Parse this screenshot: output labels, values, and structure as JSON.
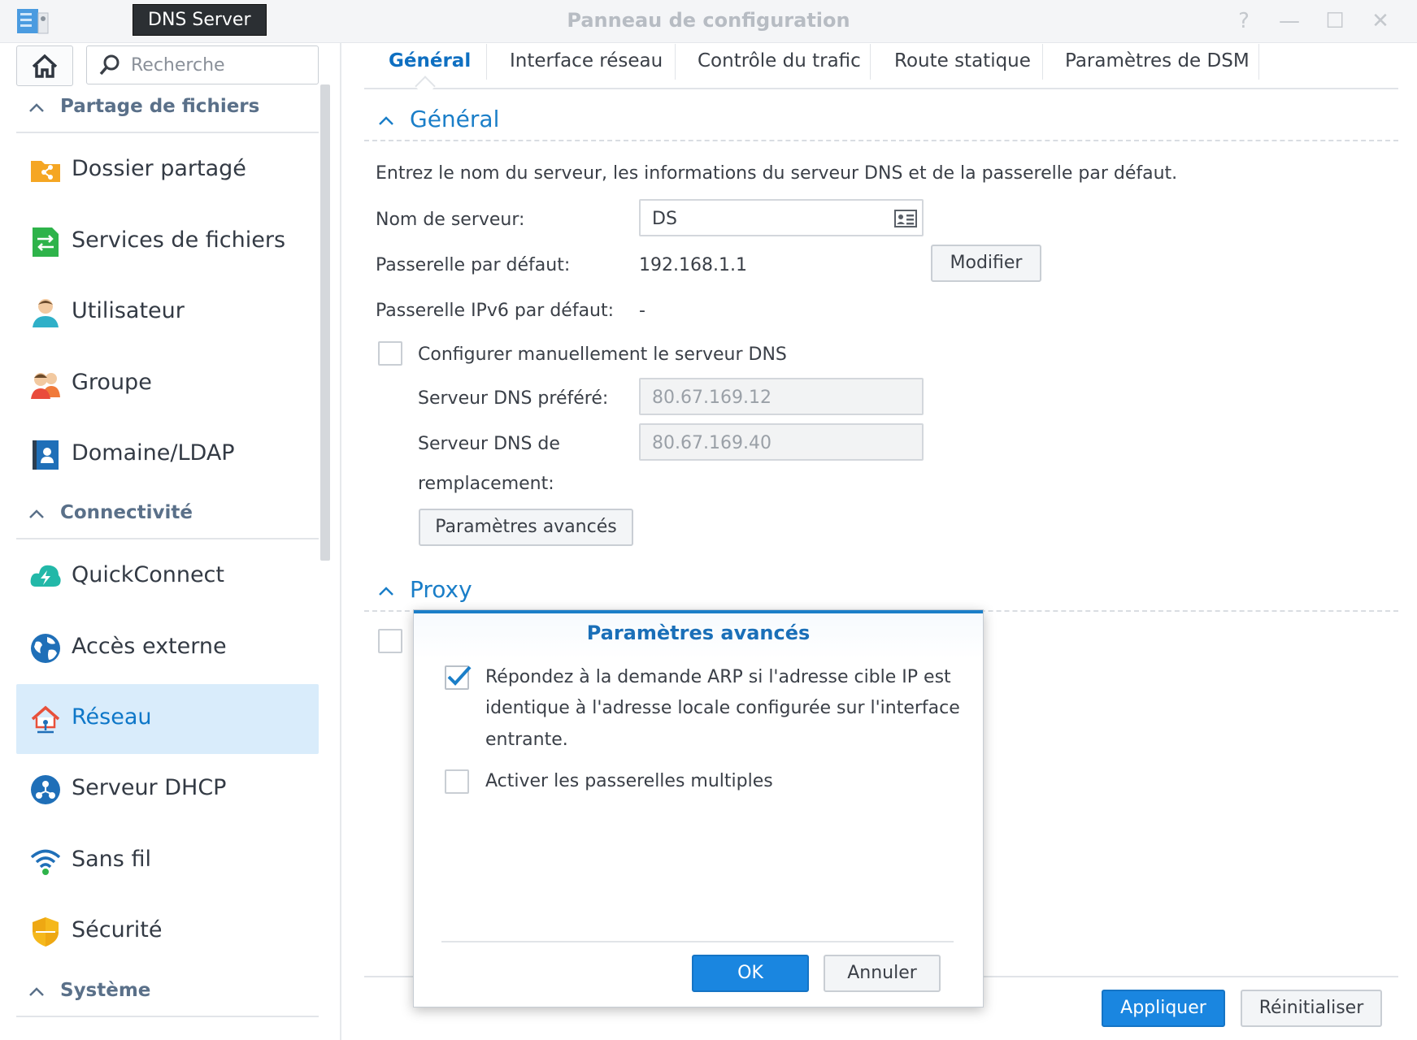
{
  "window": {
    "title": "Panneau de configuration",
    "tooltip": "DNS Server",
    "controls": [
      "?",
      "—",
      "☐",
      "✕"
    ]
  },
  "sidebar": {
    "search_placeholder": "Recherche",
    "sections": [
      {
        "label": "Partage de fichiers"
      },
      {
        "label": "Connectivité"
      },
      {
        "label": "Système"
      }
    ],
    "items": [
      {
        "label": "Dossier partagé",
        "icon": "shared-folder-icon"
      },
      {
        "label": "Services de fichiers",
        "icon": "file-services-icon"
      },
      {
        "label": "Utilisateur",
        "icon": "user-icon"
      },
      {
        "label": "Groupe",
        "icon": "group-icon"
      },
      {
        "label": "Domaine/LDAP",
        "icon": "domain-ldap-icon"
      },
      {
        "label": "QuickConnect",
        "icon": "quickconnect-icon"
      },
      {
        "label": "Accès externe",
        "icon": "external-access-icon"
      },
      {
        "label": "Réseau",
        "icon": "network-icon",
        "active": true
      },
      {
        "label": "Serveur DHCP",
        "icon": "dhcp-server-icon"
      },
      {
        "label": "Sans fil",
        "icon": "wireless-icon"
      },
      {
        "label": "Sécurité",
        "icon": "security-icon"
      }
    ]
  },
  "tabs": [
    "Général",
    "Interface réseau",
    "Contrôle du trafic",
    "Route statique",
    "Paramètres de DSM"
  ],
  "general": {
    "title": "Général",
    "description": "Entrez le nom du serveur, les informations du serveur DNS et de la passerelle par défaut.",
    "server_name_label": "Nom de serveur:",
    "server_name_value": "DS",
    "gateway_label": "Passerelle par défaut:",
    "gateway_value": "192.168.1.1",
    "modify_button": "Modifier",
    "ipv6_gateway_label": "Passerelle IPv6 par défaut:",
    "ipv6_gateway_value": "-",
    "manual_dns_label": "Configurer manuellement le serveur DNS",
    "preferred_dns_label": "Serveur DNS préféré:",
    "preferred_dns_value": "80.67.169.12",
    "alternate_dns_label_1": "Serveur DNS de",
    "alternate_dns_label_2": "remplacement:",
    "alternate_dns_value": "80.67.169.40",
    "advanced_button": "Paramètres avancés"
  },
  "proxy": {
    "title": "Proxy"
  },
  "footer": {
    "apply": "Appliquer",
    "reset": "Réinitialiser"
  },
  "modal": {
    "title": "Paramètres avancés",
    "arp_line1": "Répondez à la demande ARP si l'adresse cible IP est",
    "arp_line2": "identique à l'adresse locale configurée sur l'interface",
    "arp_line3": "entrante.",
    "arp_checked": true,
    "multi_gateway_label": "Activer les passerelles multiples",
    "multi_gateway_checked": false,
    "ok": "OK",
    "cancel": "Annuler"
  },
  "colors": {
    "accent": "#1a86e0",
    "active_bg": "#d9ecfb",
    "section_title": "#1a7ec8"
  }
}
